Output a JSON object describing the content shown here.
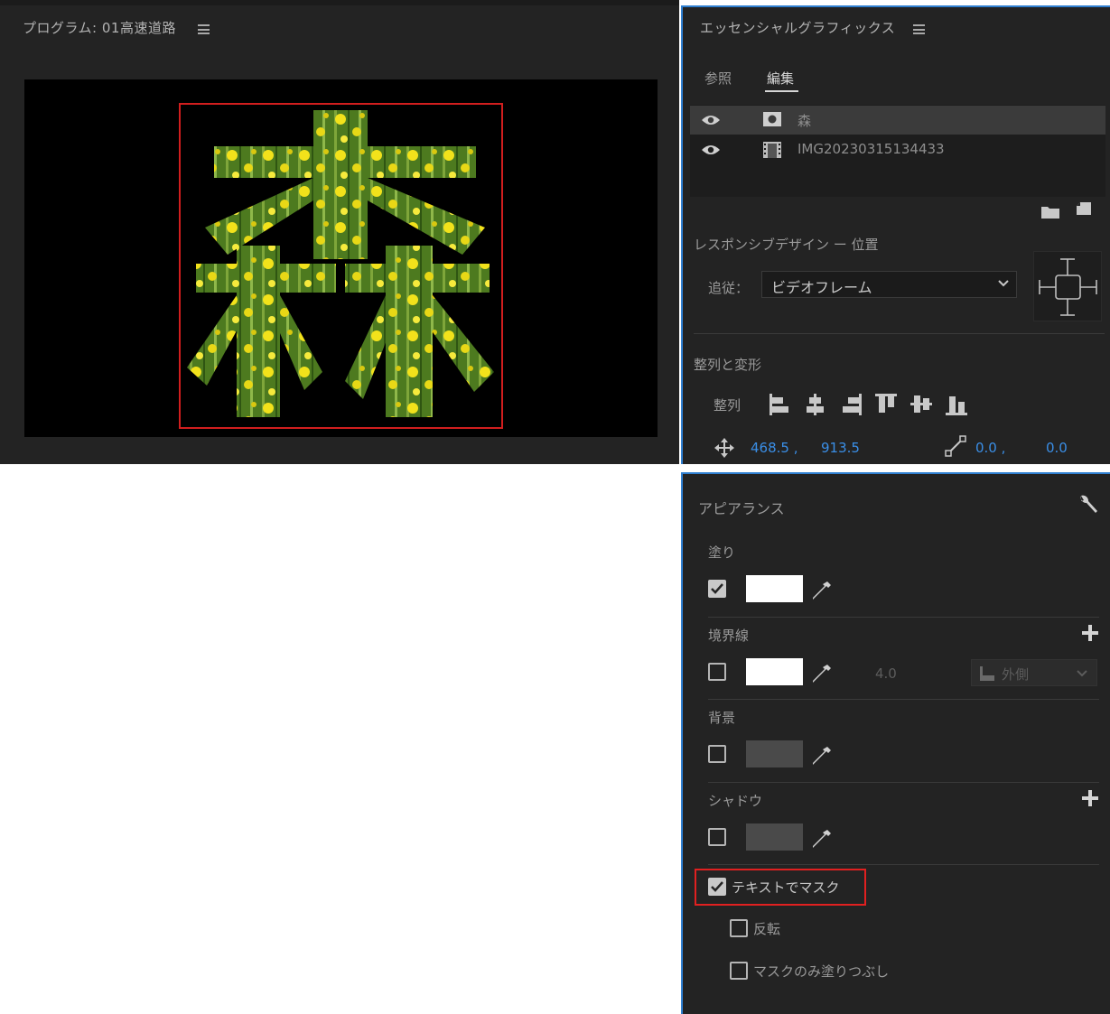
{
  "program_monitor": {
    "title": "プログラム: 01高速道路",
    "frame_content": "森"
  },
  "essential_graphics": {
    "title": "エッセンシャルグラフィックス",
    "tabs": [
      {
        "label": "参照",
        "active": false
      },
      {
        "label": "編集",
        "active": true
      }
    ],
    "layers": [
      {
        "name": "森",
        "type": "text-layer-icon",
        "selected": true
      },
      {
        "name": "IMG20230315134433",
        "type": "film-icon",
        "selected": false
      }
    ],
    "responsive_design_label": "レスポンシブデザイン ー 位置",
    "follow_label": "追従：",
    "follow_value": "ビデオフレーム",
    "align_transform_label": "整列と変形",
    "align_label": "整列",
    "position_x": "468.5 ,",
    "position_y": "913.5",
    "anchor_x": "0.0 ,",
    "anchor_y": "0.0"
  },
  "appearance": {
    "title": "アピアランス",
    "fill": {
      "label": "塗り",
      "checked": true,
      "color": "#ffffff"
    },
    "stroke": {
      "label": "境界線",
      "checked": false,
      "color": "#ffffff",
      "width": "4.0",
      "position": "外側"
    },
    "background": {
      "label": "背景",
      "checked": false,
      "color": "#4a4a4a"
    },
    "shadow": {
      "label": "シャドウ",
      "checked": false,
      "color": "#4a4a4a"
    },
    "mask_with_text": {
      "label": "テキストでマスク",
      "checked": true
    },
    "invert": {
      "label": "反転",
      "checked": false
    },
    "fill_mask_only": {
      "label": "マスクのみ塗りつぶし",
      "checked": false
    }
  },
  "colors": {
    "panel_bg": "#232323",
    "accent_blue": "#3a8ee6",
    "highlight_red": "#e02020"
  }
}
